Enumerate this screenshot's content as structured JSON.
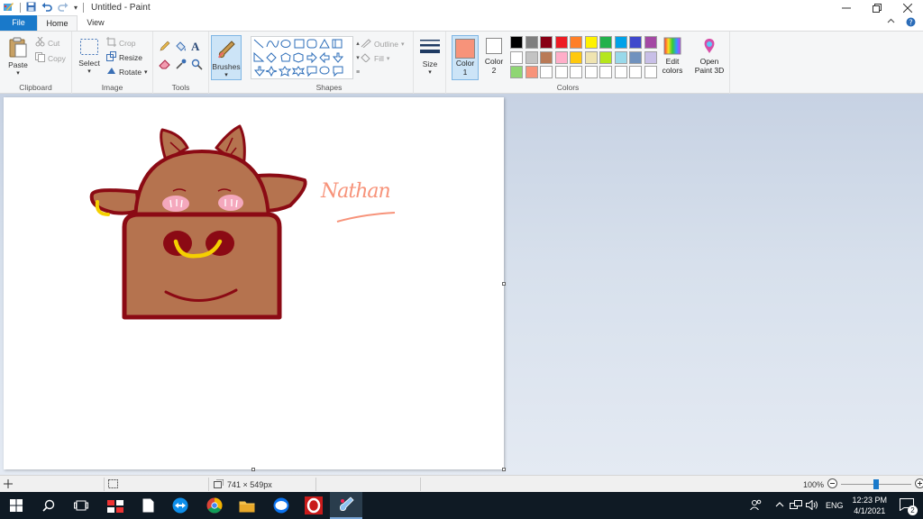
{
  "window": {
    "title": "Untitled - Paint",
    "qa_customize": "▾"
  },
  "tabs": {
    "file": "File",
    "home": "Home",
    "view": "View"
  },
  "ribbon": {
    "clipboard": {
      "label": "Clipboard",
      "paste": "Paste",
      "cut": "Cut",
      "copy": "Copy"
    },
    "image": {
      "label": "Image",
      "select": "Select",
      "crop": "Crop",
      "resize": "Resize",
      "rotate": "Rotate"
    },
    "tools": {
      "label": "Tools"
    },
    "brushes": {
      "label": "Brushes"
    },
    "shapes": {
      "label": "Shapes",
      "outline": "Outline",
      "fill": "Fill"
    },
    "size": {
      "label": "Size"
    },
    "colors": {
      "label": "Colors",
      "color1_label": "Color\n1",
      "color1_a": "Color",
      "color1_b": "1",
      "color2_a": "Color",
      "color2_b": "2",
      "edit_a": "Edit",
      "edit_b": "colors",
      "paint3d_a": "Open",
      "paint3d_b": "Paint 3D",
      "color1": "#f7937a",
      "color2": "#ffffff",
      "palette_row1": [
        "#000000",
        "#7f7f7f",
        "#880015",
        "#ed1c24",
        "#ff7f27",
        "#fff200",
        "#22b14c",
        "#00a2e8",
        "#3f48cc",
        "#a349a4"
      ],
      "palette_row2": [
        "#ffffff",
        "#c3c3c3",
        "#b97a57",
        "#ffaec9",
        "#ffc90e",
        "#efe4b0",
        "#b5e61d",
        "#99d9ea",
        "#7092be",
        "#c8bfe7"
      ],
      "palette_row3": [
        "#8fd673",
        "#f7937a",
        "#ffffff",
        "#ffffff",
        "#ffffff",
        "#ffffff",
        "#ffffff",
        "#ffffff",
        "#ffffff",
        "#ffffff"
      ]
    }
  },
  "canvas": {
    "signature": "Nathan"
  },
  "status": {
    "dimensions": "741 × 549px",
    "zoom": "100%",
    "zoom_level": 100
  },
  "taskbar": {
    "language": "ENG",
    "time": "12:23 PM",
    "date": "4/1/2021",
    "notifications": "2"
  }
}
